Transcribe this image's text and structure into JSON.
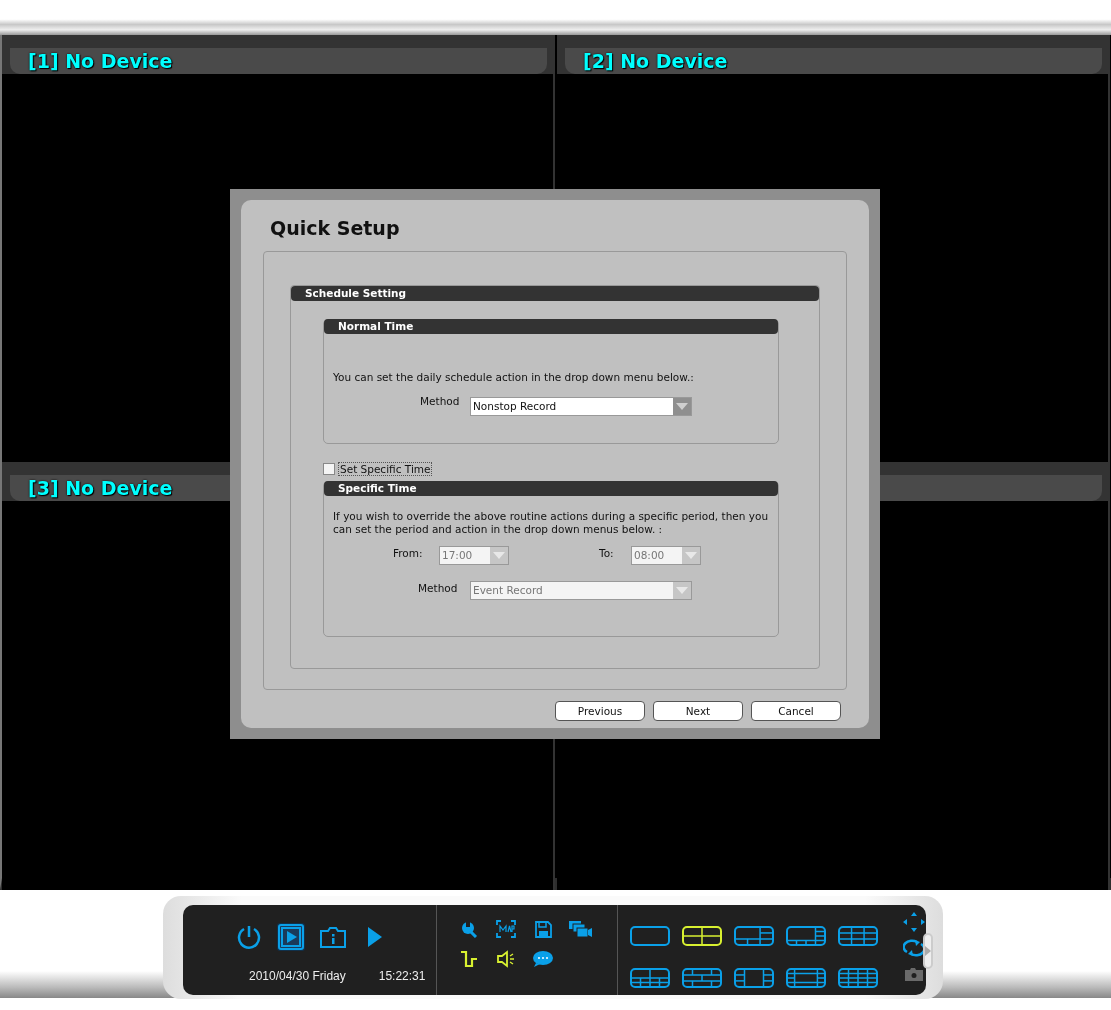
{
  "video_panels": [
    {
      "title": "[1] No Device"
    },
    {
      "title": "[2] No Device"
    },
    {
      "title": "[3] No Device"
    }
  ],
  "dialog": {
    "title": "Quick Setup",
    "section": {
      "title": "Schedule Setting",
      "normal_time": {
        "title": "Normal Time",
        "description": "You can set the daily schedule action in the drop down menu below.:",
        "method_label": "Method",
        "method_value": "Nonstop Record",
        "disabled": false
      },
      "specific_checkbox": {
        "label": "Set Specific Time",
        "checked": false
      },
      "specific_time": {
        "title": "Specific Time",
        "description": "If you wish to override the above routine actions during a specific period, then you can set the period and action in the drop down menus below. :",
        "from_label": "From:",
        "from_value": "17:00",
        "to_label": "To:",
        "to_value": "08:00",
        "method_label": "Method",
        "method_value": "Event Record",
        "disabled": true
      }
    },
    "buttons": [
      "Previous",
      "Next",
      "Cancel"
    ]
  },
  "toolbar": {
    "main_buttons": [
      {
        "kind": "power",
        "selected": false
      },
      {
        "kind": "playback",
        "selected": true
      },
      {
        "kind": "info",
        "selected": false
      },
      {
        "kind": "play",
        "selected": false
      }
    ],
    "date": "2010/04/30 Friday",
    "time": "15:22:31",
    "tools": [
      {
        "kind": "wrench",
        "active": false
      },
      {
        "kind": "map",
        "active": false
      },
      {
        "kind": "disk",
        "active": false
      },
      {
        "kind": "cameras",
        "active": false
      },
      {
        "kind": "pulse",
        "active": true
      },
      {
        "kind": "speaker",
        "active": true
      },
      {
        "kind": "chat",
        "active": false
      }
    ],
    "layouts": [
      {
        "kind": "single",
        "selected": false
      },
      {
        "kind": "quad",
        "selected": true
      },
      {
        "kind": "six",
        "selected": false
      },
      {
        "kind": "eight",
        "selected": false
      },
      {
        "kind": "nine",
        "selected": false
      },
      {
        "kind": "ten",
        "selected": false
      },
      {
        "kind": "thirteen",
        "selected": false
      },
      {
        "kind": "split",
        "selected": false
      },
      {
        "kind": "center",
        "selected": false
      },
      {
        "kind": "sixteen",
        "selected": false
      }
    ],
    "side_tools": [
      {
        "kind": "move",
        "disabled": false
      },
      {
        "kind": "cycle",
        "disabled": false
      },
      {
        "kind": "snapshot",
        "disabled": true
      }
    ]
  }
}
